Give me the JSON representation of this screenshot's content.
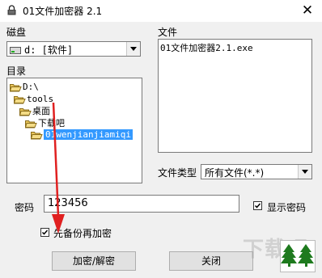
{
  "window": {
    "title": "01文件加密器 2.1",
    "close_glyph": "✕"
  },
  "drive": {
    "label": "磁盘",
    "value": "d: [软件]",
    "icon": "drive-icon"
  },
  "directory": {
    "label": "目录",
    "items": [
      "D:\\",
      "tools",
      "桌面",
      "下载吧",
      "01wenjianjiamiqi"
    ],
    "selected_index": 4
  },
  "files": {
    "label": "文件",
    "items": [
      "01文件加密器2.1.exe"
    ]
  },
  "filetype": {
    "label": "文件类型",
    "value": "所有文件(*.*)"
  },
  "password": {
    "label": "密码",
    "value": "123456"
  },
  "show_password": {
    "label": "显示密码",
    "checked": true
  },
  "backup_before_encrypt": {
    "label": "先备份再加密",
    "checked": true
  },
  "buttons": {
    "encrypt_decrypt": "加密/解密",
    "close": "关闭"
  },
  "watermark": {
    "text": "下载吧"
  },
  "colors": {
    "selection": "#3399ff",
    "arrow": "#e02020",
    "logo_green": "#1e7a1e"
  }
}
